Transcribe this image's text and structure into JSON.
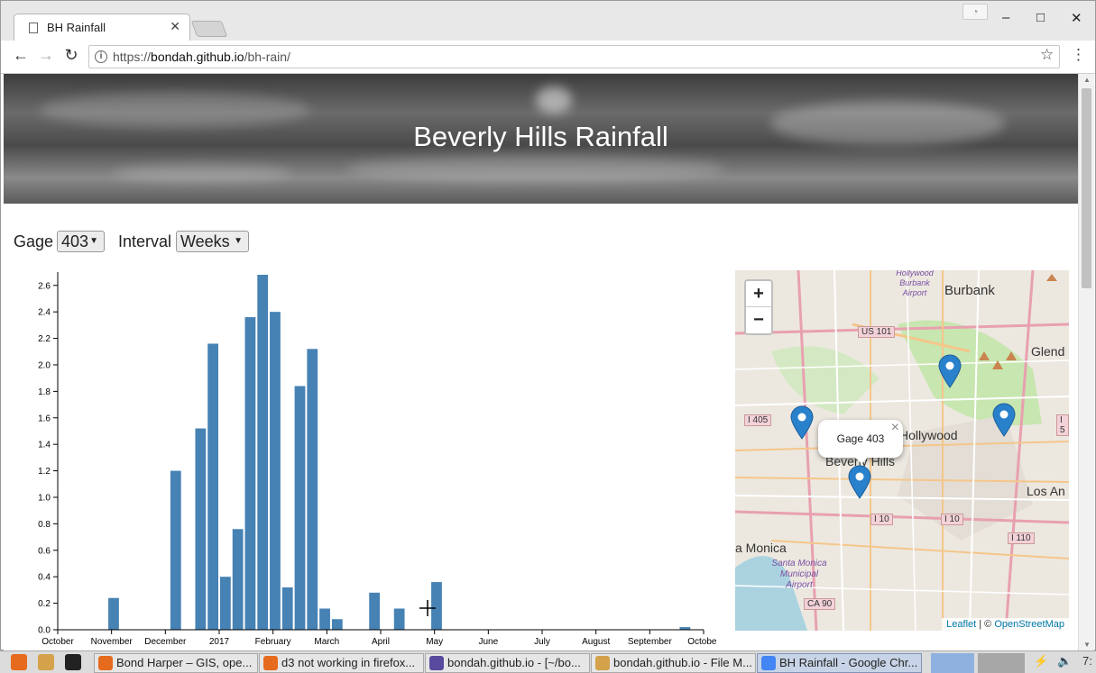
{
  "browser": {
    "tab_title": "BH Rainfall",
    "tab_close": "✕",
    "url_scheme": "https://",
    "url_host": "bondah.github.io",
    "url_path": "/bh-rain/",
    "back": "←",
    "forward": "→",
    "reload": "↻",
    "star": "☆",
    "menu": "⋮",
    "minimize": "–",
    "maximize": "□",
    "close": "✕"
  },
  "page": {
    "title": "Beverly Hills Rainfall",
    "gage_label": "Gage",
    "gage_value": "403",
    "interval_label": "Interval",
    "interval_value": "Weeks"
  },
  "chart_data": {
    "type": "bar",
    "title": "",
    "xlabel": "",
    "ylabel": "",
    "ylim": [
      0,
      2.68
    ],
    "y_ticks": [
      "0.0",
      "0.2",
      "0.4",
      "0.6",
      "0.8",
      "1.0",
      "1.2",
      "1.4",
      "1.6",
      "1.8",
      "2.0",
      "2.2",
      "2.4",
      "2.6"
    ],
    "x_ticks": [
      "October",
      "November",
      "December",
      "2017",
      "February",
      "March",
      "April",
      "May",
      "June",
      "July",
      "August",
      "September",
      "October"
    ],
    "bar_color": "#4682b4",
    "week_values": [
      0,
      0,
      0,
      0,
      0.24,
      0,
      0,
      0,
      0,
      1.2,
      0,
      1.52,
      2.16,
      0.4,
      0.76,
      2.36,
      2.68,
      2.4,
      0.32,
      1.84,
      2.12,
      0.16,
      0.08,
      0,
      0,
      0.28,
      0,
      0.16,
      0,
      0,
      0.36,
      0,
      0,
      0,
      0,
      0,
      0,
      0,
      0,
      0,
      0,
      0,
      0,
      0,
      0,
      0,
      0,
      0,
      0,
      0,
      0.02,
      0
    ]
  },
  "map": {
    "zoom_in": "+",
    "zoom_out": "−",
    "popup_text": "Gage 403",
    "popup_close": "×",
    "attr_leaflet": "Leaflet",
    "attr_sep": " | © ",
    "attr_osm": "OpenStreetMap",
    "labels": {
      "burbank": "Burbank",
      "hollywood": "Hollywood",
      "beverly_hills": "Beverly Hills",
      "los_angeles": "Los An",
      "glendale": "Glend",
      "santa_monica": "a Monica",
      "smma": "Santa Monica Municipal Airport",
      "bba": "Hollywood Burbank Airport"
    },
    "shields": [
      "US 101",
      "I 405",
      "I 10",
      "I 10",
      "I 110",
      "CA 90",
      "I 5"
    ]
  },
  "taskbar": {
    "tasks": [
      "Bond Harper – GIS, ope...",
      "d3 not working in firefox...",
      "bondah.github.io - [~/bo...",
      "bondah.github.io - File M...",
      "BH Rainfall - Google Chr..."
    ],
    "clock": "7:"
  }
}
